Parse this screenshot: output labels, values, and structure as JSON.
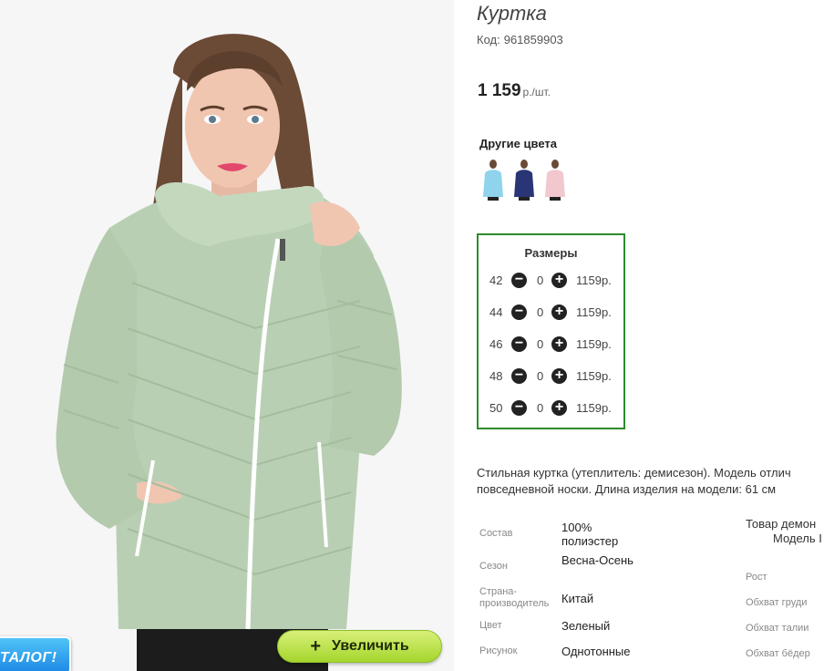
{
  "product": {
    "title": "Куртка",
    "code_label": "Код:",
    "code_value": "961859903",
    "price_value": "1 159",
    "price_unit": "р./шт."
  },
  "other_colors": {
    "heading": "Другие цвета",
    "swatches": [
      {
        "name": "light-blue",
        "color": "#8fd3ec"
      },
      {
        "name": "navy",
        "color": "#2a3576"
      },
      {
        "name": "pink",
        "color": "#f2c8cf"
      }
    ]
  },
  "sizes": {
    "heading": "Размеры",
    "rows": [
      {
        "size": "42",
        "qty": "0",
        "price": "1159р."
      },
      {
        "size": "44",
        "qty": "0",
        "price": "1159р."
      },
      {
        "size": "46",
        "qty": "0",
        "price": "1159р."
      },
      {
        "size": "48",
        "qty": "0",
        "price": "1159р."
      },
      {
        "size": "50",
        "qty": "0",
        "price": "1159р."
      }
    ],
    "minus_symbol": "−",
    "plus_symbol": "+"
  },
  "description": {
    "line1": "Стильная куртка (утеплитель: демисезон). Модель отлич",
    "line2": "повседневной носки. Длина изделия на модели: 61 см"
  },
  "specs": [
    {
      "label": "Состав",
      "value": "100% полиэстер"
    },
    {
      "label": "Сезон",
      "value": "Весна-Осень"
    },
    {
      "label": "Страна-производитель",
      "value": "Китай"
    },
    {
      "label": "Цвет",
      "value": "Зеленый"
    },
    {
      "label": "Рисунок",
      "value": "Однотонные"
    }
  ],
  "model": {
    "line1": "Товар демон",
    "line2": "Модель I",
    "measurements": [
      "Рост",
      "Обхват груди",
      "Обхват талии",
      "Обхват бёдер"
    ]
  },
  "buttons": {
    "zoom_plus": "+",
    "zoom_label": "Увеличить",
    "catalog_label": "ТАЛОГ!"
  },
  "colors": {
    "jacket": "#b9cfb3",
    "border_green": "#2e8b2e",
    "zoom_button": "#a5d62c"
  }
}
